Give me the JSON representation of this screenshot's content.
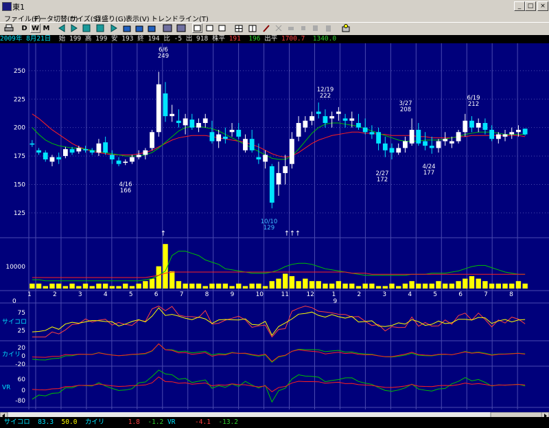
{
  "window": {
    "title": "東1",
    "min": "_",
    "max": "□",
    "close": "×"
  },
  "menu": [
    "ファイル(F)",
    "データ切替(D)",
    "サイズ(S)",
    "目盛り(G)",
    "表示(V)",
    "トレンドライン(T)"
  ],
  "toolbar": {
    "daily": "D",
    "weekly": "W",
    "monthly": "M"
  },
  "info": {
    "date": "2009年 8月21日",
    "open_label": "始",
    "open": "199",
    "high_label": "高",
    "high": "199",
    "low_label": "安",
    "low": "193",
    "close_label": "終",
    "close": "194",
    "change_label": "比",
    "change": "-5",
    "volume_label": "出",
    "volume": "918",
    "avg_label": "株平",
    "avg1": "191",
    "avg2": "196",
    "vol_avg_label": "出平",
    "vol_avg1": "1700.7",
    "vol_avg2": "1340.0"
  },
  "status": {
    "psy_label": "サイコロ",
    "psy1": "83.3",
    "psy2": "50.0",
    "kairi_label": "カイリ",
    "kairi1": "1.8",
    "kairi2": "-1.2",
    "vr_label": "VR",
    "vr1": "-4.1",
    "vr2": "-13.2"
  },
  "colors": {
    "bg": "#00007b",
    "up": "#ffffff",
    "down": "#00e5ff",
    "ma_short": "#ff2020",
    "ma_long": "#00c000",
    "volume": "#ffff00",
    "grid": "#4a4ab0"
  },
  "chart_data": {
    "type": "candlestick",
    "y_axis": {
      "ticks": [
        250,
        225,
        200,
        175,
        150,
        125
      ],
      "ylim": [
        105,
        265
      ]
    },
    "volume_axis": {
      "ticks": [
        10000
      ]
    },
    "x_month_labels": [
      "1",
      "2",
      "3",
      "4",
      "5",
      "6",
      "7",
      "8",
      "9",
      "10",
      "11",
      "12",
      "1",
      "2",
      "3",
      "4",
      "5",
      "6",
      "7",
      "8"
    ],
    "x_year_labels": [
      "0",
      "9"
    ],
    "annotations": [
      {
        "date": "6/6",
        "value": "249"
      },
      {
        "date": "4/16",
        "value": "166"
      },
      {
        "date": "10/10",
        "value": "129"
      },
      {
        "date": "12/19",
        "value": "222"
      },
      {
        "date": "2/27",
        "value": "172"
      },
      {
        "date": "3/27",
        "value": "208"
      },
      {
        "date": "4/24",
        "value": "177"
      },
      {
        "date": "6/19",
        "value": "212"
      }
    ],
    "panels": [
      {
        "name": "サイコロ",
        "ticks": [
          75,
          25
        ]
      },
      {
        "name": "カイリ",
        "ticks": [
          20,
          0,
          -20
        ]
      },
      {
        "name": "VR",
        "ticks": [
          60,
          0,
          -80
        ]
      }
    ],
    "candles": [
      [
        186,
        189,
        183,
        185
      ],
      [
        180,
        182,
        176,
        178
      ],
      [
        178,
        180,
        170,
        172
      ],
      [
        170,
        176,
        166,
        174
      ],
      [
        174,
        178,
        168,
        172
      ],
      [
        175,
        183,
        173,
        181
      ],
      [
        181,
        183,
        176,
        178
      ],
      [
        179,
        184,
        177,
        182
      ],
      [
        181,
        184,
        178,
        180
      ],
      [
        180,
        182,
        176,
        178
      ],
      [
        178,
        190,
        175,
        186
      ],
      [
        187,
        192,
        176,
        178
      ],
      [
        176,
        180,
        168,
        172
      ],
      [
        171,
        174,
        166,
        168
      ],
      [
        169,
        172,
        167,
        170
      ],
      [
        170,
        176,
        168,
        174
      ],
      [
        174,
        180,
        172,
        176
      ],
      [
        176,
        182,
        172,
        180
      ],
      [
        182,
        198,
        180,
        196
      ],
      [
        196,
        249,
        192,
        238
      ],
      [
        230,
        240,
        205,
        210
      ],
      [
        210,
        220,
        205,
        212
      ],
      [
        206,
        216,
        200,
        204
      ],
      [
        202,
        212,
        194,
        208
      ],
      [
        207,
        212,
        198,
        200
      ],
      [
        200,
        208,
        196,
        204
      ],
      [
        204,
        212,
        200,
        208
      ],
      [
        196,
        206,
        186,
        188
      ],
      [
        188,
        198,
        182,
        194
      ],
      [
        192,
        200,
        186,
        190
      ],
      [
        196,
        204,
        192,
        198
      ],
      [
        198,
        204,
        190,
        192
      ],
      [
        180,
        194,
        178,
        190
      ],
      [
        190,
        198,
        178,
        180
      ],
      [
        174,
        186,
        168,
        172
      ],
      [
        170,
        180,
        164,
        176
      ],
      [
        166,
        168,
        129,
        134
      ],
      [
        150,
        170,
        140,
        160
      ],
      [
        160,
        176,
        150,
        166
      ],
      [
        168,
        196,
        164,
        190
      ],
      [
        192,
        210,
        188,
        204
      ],
      [
        200,
        210,
        196,
        206
      ],
      [
        206,
        214,
        202,
        210
      ],
      [
        214,
        222,
        208,
        212
      ],
      [
        210,
        216,
        200,
        204
      ],
      [
        208,
        214,
        200,
        210
      ],
      [
        212,
        218,
        206,
        214
      ],
      [
        208,
        212,
        200,
        206
      ],
      [
        206,
        214,
        200,
        208
      ],
      [
        204,
        212,
        198,
        200
      ],
      [
        200,
        208,
        194,
        196
      ],
      [
        196,
        202,
        190,
        194
      ],
      [
        196,
        200,
        180,
        186
      ],
      [
        186,
        192,
        174,
        180
      ],
      [
        182,
        186,
        172,
        178
      ],
      [
        178,
        186,
        176,
        182
      ],
      [
        182,
        192,
        178,
        188
      ],
      [
        186,
        208,
        184,
        198
      ],
      [
        198,
        204,
        184,
        186
      ],
      [
        188,
        196,
        180,
        184
      ],
      [
        184,
        192,
        177,
        182
      ],
      [
        182,
        190,
        178,
        188
      ],
      [
        188,
        196,
        184,
        190
      ],
      [
        186,
        192,
        182,
        188
      ],
      [
        188,
        198,
        186,
        196
      ],
      [
        196,
        212,
        192,
        206
      ],
      [
        206,
        210,
        196,
        200
      ],
      [
        200,
        208,
        196,
        204
      ],
      [
        204,
        208,
        194,
        198
      ],
      [
        198,
        202,
        188,
        190
      ],
      [
        190,
        196,
        186,
        194
      ],
      [
        192,
        198,
        188,
        194
      ],
      [
        194,
        200,
        190,
        196
      ],
      [
        196,
        202,
        192,
        198
      ],
      [
        199,
        199,
        193,
        194
      ]
    ],
    "volumes": [
      2,
      2,
      1,
      2,
      2,
      1,
      2,
      1,
      2,
      1,
      2,
      2,
      1,
      1,
      2,
      1,
      2,
      3,
      4,
      9,
      18,
      7,
      3,
      2,
      2,
      2,
      1,
      2,
      2,
      2,
      1,
      2,
      1,
      2,
      2,
      1,
      3,
      4,
      6,
      5,
      3,
      4,
      3,
      3,
      2,
      2,
      3,
      2,
      2,
      1,
      2,
      2,
      1,
      1,
      2,
      1,
      2,
      3,
      2,
      2,
      2,
      3,
      2,
      2,
      3,
      4,
      5,
      4,
      3,
      2,
      2,
      2,
      2,
      3,
      2
    ],
    "ma_short": [
      212,
      208,
      203,
      198,
      194,
      190,
      186,
      183,
      181,
      179,
      178,
      177,
      176,
      176,
      176,
      176,
      177,
      178,
      180,
      183,
      186,
      189,
      191,
      192,
      193,
      193,
      193,
      192,
      191,
      190,
      189,
      188,
      187,
      185,
      183,
      180,
      177,
      175,
      174,
      175,
      178,
      182,
      186,
      189,
      191,
      193,
      194,
      195,
      196,
      196,
      195,
      195,
      194,
      194,
      193,
      193,
      193,
      193,
      192,
      192,
      191,
      191,
      191,
      191,
      192,
      192,
      193,
      193,
      193,
      193,
      193,
      193,
      193,
      193,
      192
    ],
    "ma_long": [
      200,
      194,
      189,
      186,
      184,
      183,
      182,
      182,
      181,
      180,
      179,
      178,
      177,
      176,
      175,
      175,
      175,
      176,
      178,
      182,
      187,
      192,
      197,
      200,
      201,
      201,
      200,
      199,
      197,
      194,
      191,
      188,
      185,
      182,
      179,
      176,
      173,
      172,
      172,
      175,
      181,
      188,
      195,
      200,
      203,
      204,
      204,
      203,
      202,
      201,
      199,
      197,
      195,
      193,
      191,
      189,
      188,
      188,
      188,
      189,
      189,
      189,
      190,
      191,
      192,
      194,
      195,
      196,
      196,
      196,
      195,
      194,
      194,
      194,
      194
    ]
  }
}
